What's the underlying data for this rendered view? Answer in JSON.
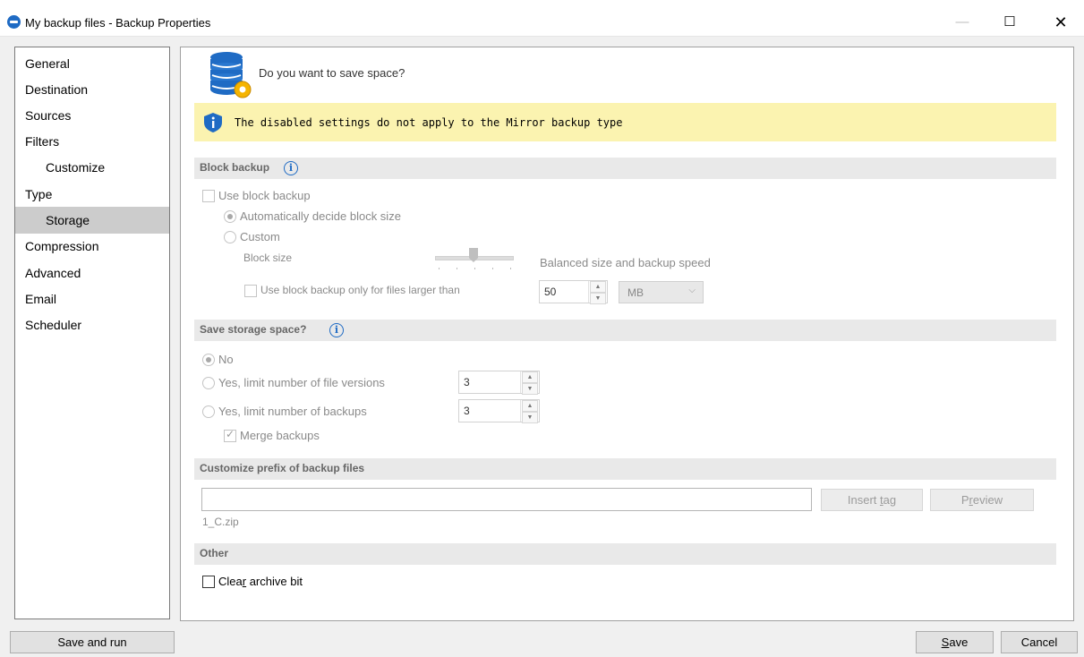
{
  "window": {
    "title": "My backup files - Backup Properties",
    "min_glyph": "—",
    "max_glyph": "☐",
    "close_glyph": "✕"
  },
  "sidebar": {
    "items": [
      {
        "label": "General"
      },
      {
        "label": "Destination"
      },
      {
        "label": "Sources"
      },
      {
        "label": "Filters"
      },
      {
        "label": "Customize"
      },
      {
        "label": "Type"
      },
      {
        "label": "Storage"
      },
      {
        "label": "Compression"
      },
      {
        "label": "Advanced"
      },
      {
        "label": "Email"
      },
      {
        "label": "Scheduler"
      }
    ],
    "selected": "Storage"
  },
  "main": {
    "heading": "Do you want to save space?",
    "banner": "The disabled settings do not apply to the Mirror backup type",
    "block_backup": {
      "section_title": "Block backup",
      "use_block_backup": "Use block backup",
      "auto_block_size": "Automatically decide block size",
      "custom": "Custom",
      "block_size_label": "Block size",
      "block_size_value": "Balanced size and backup speed",
      "larger_than_label": "Use block backup only for files larger than",
      "larger_than_value": "50",
      "unit": "MB"
    },
    "save_storage": {
      "section_title": "Save storage space?",
      "no": "No",
      "limit_versions": "Yes, limit number of file versions",
      "limit_versions_value": "3",
      "limit_backups": "Yes, limit number of backups",
      "limit_backups_value": "3",
      "merge_backups": "Merge backups"
    },
    "prefix": {
      "section_title": "Customize prefix of backup files",
      "value": "",
      "insert_tag_pre": "Insert ",
      "insert_tag_key": "t",
      "insert_tag_post": "ag",
      "preview_pre": "P",
      "preview_key": "r",
      "preview_post": "eview",
      "example": "1_C.zip"
    },
    "other": {
      "section_title": "Other",
      "clear_pre": "Clea",
      "clear_key": "r",
      "clear_post": " archive bit"
    }
  },
  "footer": {
    "save_and_run": "Save and run",
    "save_key": "S",
    "save_post": "ave",
    "cancel": "Cancel"
  },
  "colors": {
    "banner_bg": "#fbf3b0",
    "accent": "#1f6bc4",
    "selected_nav": "#cccccc"
  }
}
